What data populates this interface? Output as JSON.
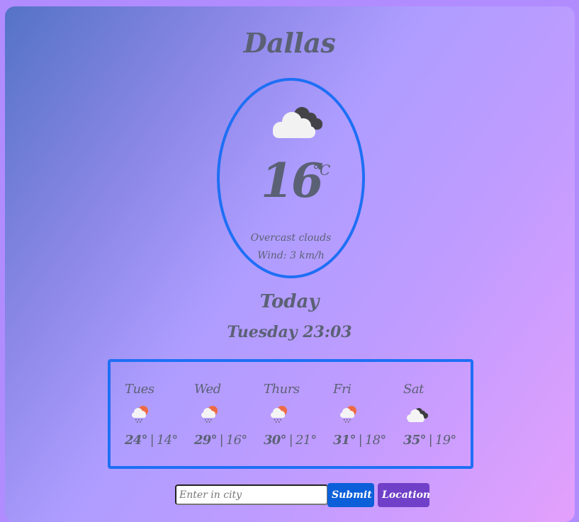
{
  "current": {
    "city": "Dallas",
    "icon": "overcast-clouds-icon",
    "temperature": "16",
    "unit": "°C",
    "description": "Overcast clouds",
    "wind": "Wind: 3 km/h"
  },
  "today": {
    "label": "Today",
    "datetime": "Tuesday 23:03"
  },
  "forecast": [
    {
      "day": "Tues",
      "icon": "rain-sun-icon",
      "high": "24°",
      "low": "14°"
    },
    {
      "day": "Wed",
      "icon": "rain-sun-icon",
      "high": "29°",
      "low": "16°"
    },
    {
      "day": "Thurs",
      "icon": "rain-sun-icon",
      "high": "30°",
      "low": "21°"
    },
    {
      "day": "Fri",
      "icon": "rain-sun-icon",
      "high": "31°",
      "low": "18°"
    },
    {
      "day": "Sat",
      "icon": "overcast-clouds-icon",
      "high": "35°",
      "low": "19°"
    }
  ],
  "forecast_separator": "|",
  "search": {
    "placeholder": "Enter in city",
    "value": "",
    "submit_label": "Submit",
    "location_label": "Location"
  },
  "colors": {
    "accent_border": "#1e6ff5",
    "submit_button": "#0b5fd9",
    "location_button": "#7040c8",
    "text": "#5b6175"
  }
}
